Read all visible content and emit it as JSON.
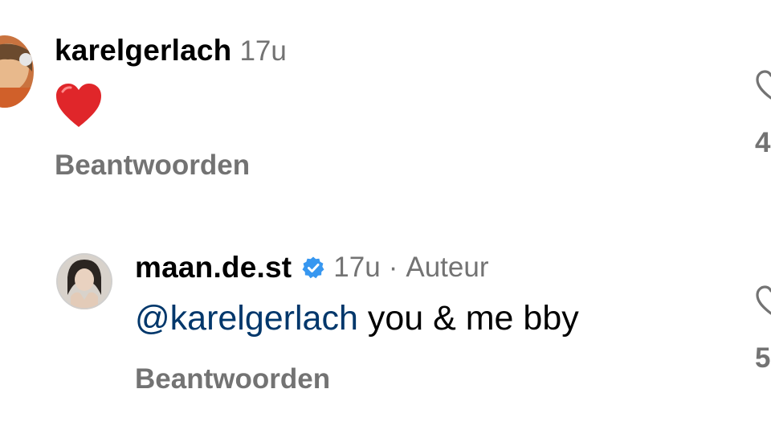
{
  "comments": [
    {
      "username": "karelgerlach",
      "time": "17u",
      "body_emoji": "heart",
      "reply_label": "Beantwoorden",
      "like_count": "4"
    },
    {
      "username": "maan.de.st",
      "verified": true,
      "time": "17u",
      "separator": "·",
      "author_label": "Auteur",
      "mention": "@karelgerlach",
      "text": " you & me bby",
      "reply_label": "Beantwoorden",
      "like_count": "5"
    }
  ],
  "icons": {
    "verified": "verified-badge-icon",
    "like": "heart-outline-icon",
    "emoji": "red-heart-emoji"
  },
  "colors": {
    "secondary_text": "#737373",
    "mention": "#00376b",
    "verified": "#3797f0",
    "heart": "#e0262a"
  }
}
